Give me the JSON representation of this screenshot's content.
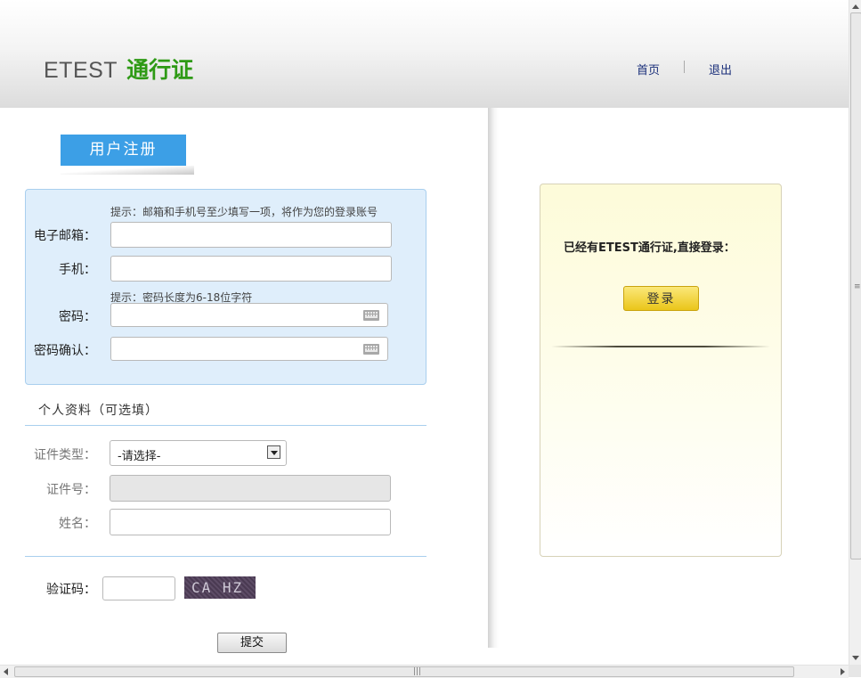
{
  "header": {
    "brand": "ETEST",
    "brand_suffix": "通行证",
    "nav": {
      "home": "首页",
      "logout": "退出"
    }
  },
  "register": {
    "tab_label": "用户注册",
    "hint_contact": "提示：邮箱和手机号至少填写一项，将作为您的登录账号",
    "email_label": "电子邮箱：",
    "phone_label": "手机：",
    "hint_password": "提示：密码长度为6-18位字符",
    "password_label": "密码：",
    "confirm_label": "密码确认：",
    "email_value": "",
    "phone_value": "",
    "password_value": "",
    "confirm_value": ""
  },
  "personal": {
    "section_title": "个人资料（可选填）",
    "id_type_label": "证件类型：",
    "id_type_selected": "-请选择-",
    "id_number_label": "证件号：",
    "name_label": "姓名：",
    "id_number_value": "",
    "name_value": ""
  },
  "captcha": {
    "label": "验证码：",
    "value": "",
    "image_text": "CA HZ"
  },
  "submit_label": "提交",
  "login_card": {
    "text": "已经有ETEST通行证,直接登录：",
    "button": "登录"
  },
  "colors": {
    "tab_blue": "#3c9fe6",
    "brand_green": "#2e9a15",
    "box_bg": "#dfeefb",
    "login_yellow": "#eac51a"
  }
}
